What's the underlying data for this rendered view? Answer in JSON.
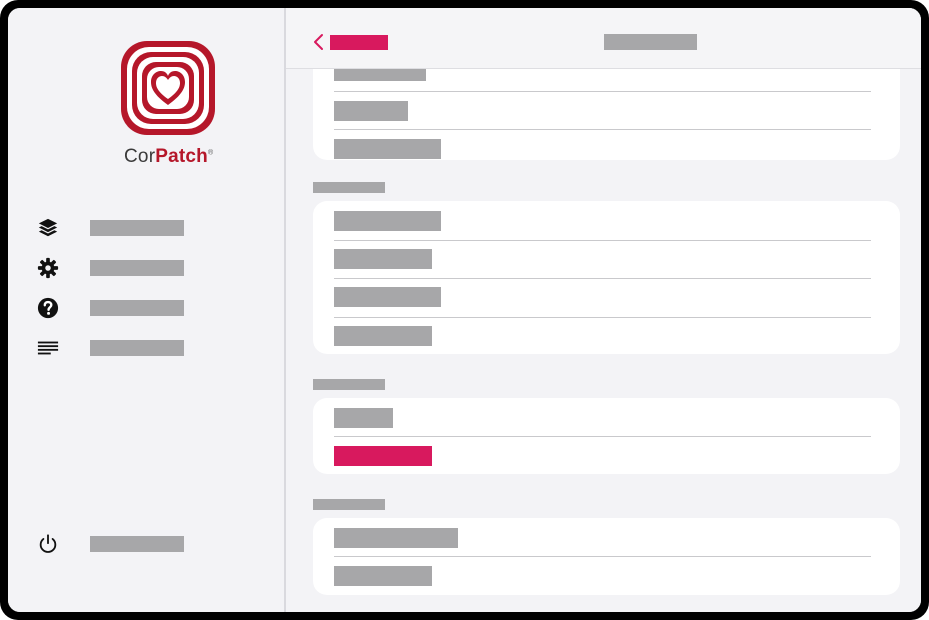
{
  "app": {
    "brand_part1": "Cor",
    "brand_part2": "Patch",
    "brand_mark": "®",
    "accent_color": "#d8195e",
    "logo_color": "#b5172a"
  },
  "sidebar": {
    "items": [
      {
        "icon": "layers-icon",
        "label": ""
      },
      {
        "icon": "gear-icon",
        "label": ""
      },
      {
        "icon": "help-icon",
        "label": ""
      },
      {
        "icon": "menu-lines-icon",
        "label": ""
      }
    ],
    "footer": {
      "icon": "power-icon",
      "label": ""
    }
  },
  "header": {
    "back_icon": "chevron-left-icon",
    "back_label": "",
    "title": ""
  },
  "sections": [
    {
      "label": "",
      "rows": [
        "",
        "",
        ""
      ]
    },
    {
      "label": "",
      "rows": [
        "",
        "",
        "",
        ""
      ]
    },
    {
      "label": "",
      "rows": [
        "",
        ""
      ],
      "active_row": 1
    },
    {
      "label": "",
      "rows": [
        "",
        ""
      ]
    }
  ]
}
